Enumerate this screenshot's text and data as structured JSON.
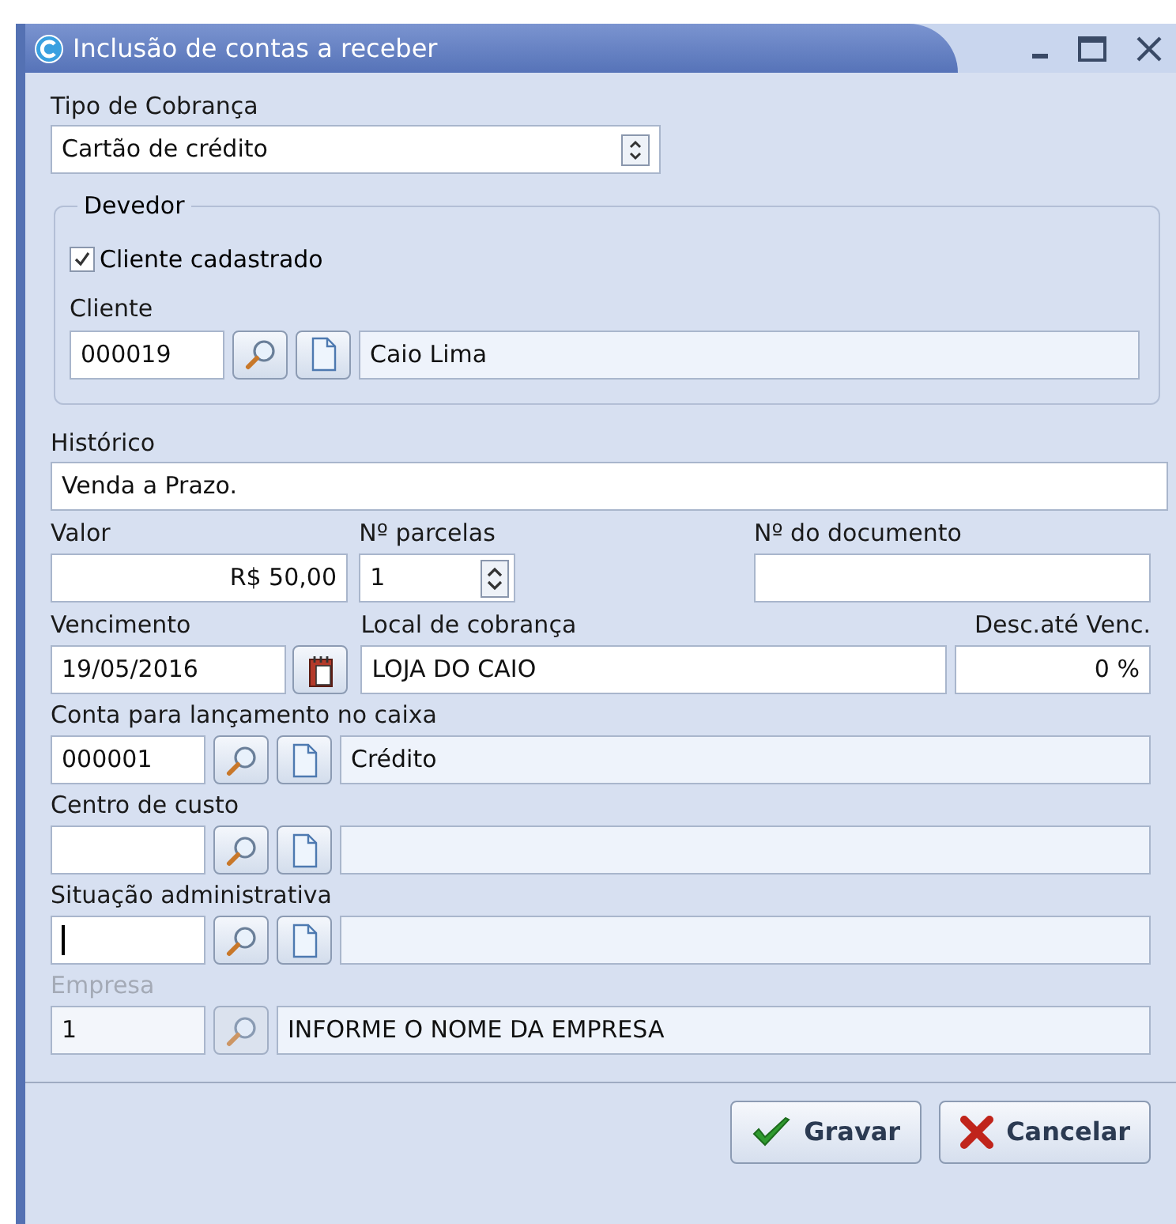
{
  "window": {
    "title": "Inclusão de contas a receber"
  },
  "billing_type": {
    "label": "Tipo de Cobrança",
    "value": "Cartão de crédito"
  },
  "debtor_group": {
    "legend": "Devedor",
    "registered_client": {
      "label": "Cliente cadastrado",
      "checked": true
    },
    "client": {
      "label": "Cliente",
      "code": "000019",
      "description": "Caio Lima"
    }
  },
  "history": {
    "label": "Histórico",
    "value": "Venda a Prazo."
  },
  "amount": {
    "label": "Valor",
    "value": "R$ 50,00"
  },
  "installments": {
    "label": "Nº parcelas",
    "value": "1"
  },
  "document_number": {
    "label": "Nº do documento"
  },
  "due_date": {
    "label": "Vencimento",
    "value": "19/05/2016"
  },
  "collection_place": {
    "label": "Local de cobrança",
    "value": "LOJA DO CAIO"
  },
  "discount": {
    "label": "Desc.até Venc.",
    "value": "0 %"
  },
  "lookups": [
    {
      "label": "Conta para lançamento no caixa",
      "code": "000001",
      "description": "Crédito",
      "new_button": true,
      "focused": false,
      "disabled": false
    },
    {
      "label": "Centro de custo",
      "new_button": true,
      "focused": false,
      "disabled": false
    },
    {
      "label": "Situação administrativa",
      "new_button": true,
      "focused": true,
      "disabled": false
    },
    {
      "label": "Empresa",
      "code": "1",
      "description": "INFORME O NOME DA EMPRESA",
      "new_button": false,
      "focused": false,
      "disabled": true
    }
  ],
  "buttons": [
    {
      "kind": "save",
      "label": "Gravar"
    },
    {
      "kind": "cancel",
      "label": "Cancelar"
    }
  ]
}
